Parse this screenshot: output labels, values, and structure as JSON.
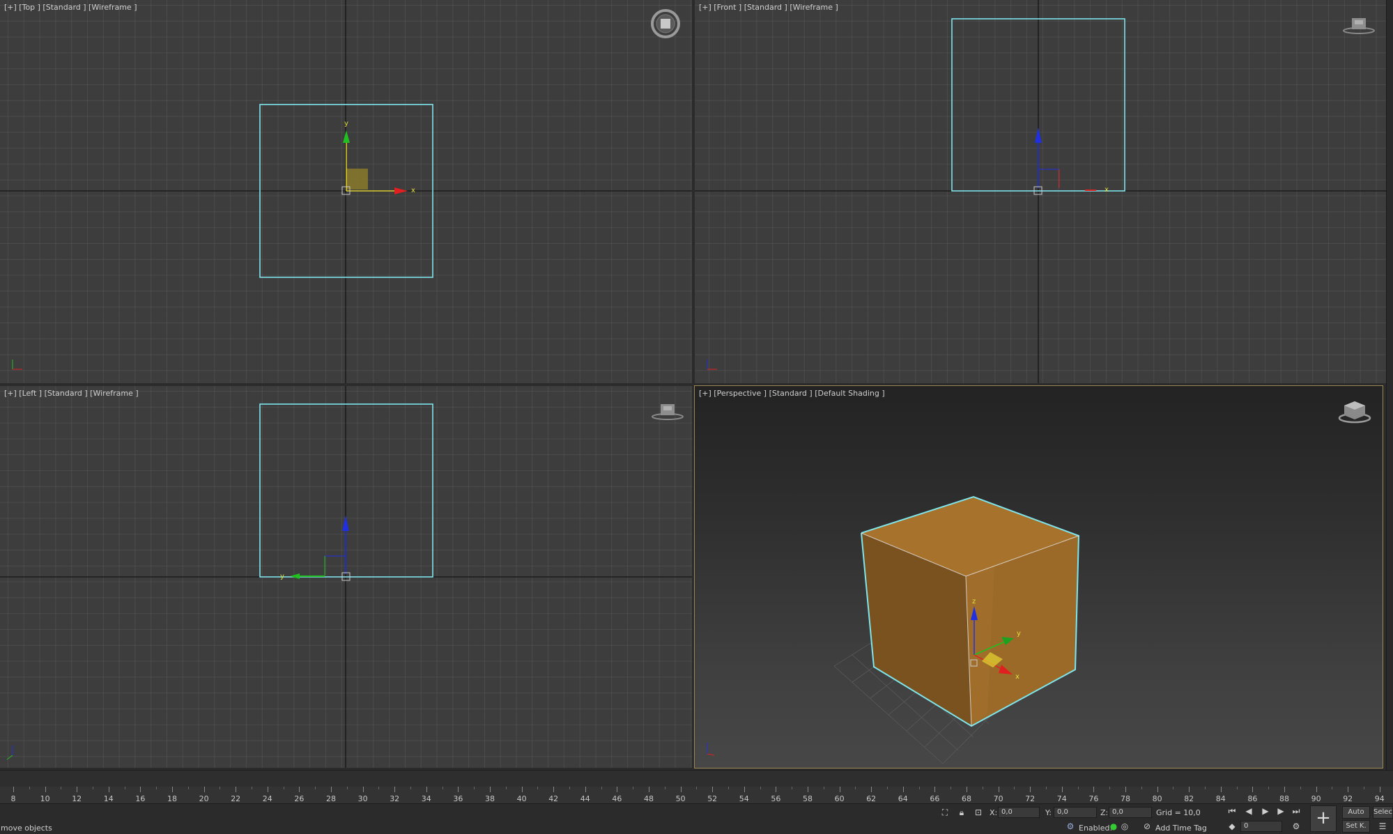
{
  "viewports": {
    "top": {
      "label": "[+] [Top ] [Standard ] [Wireframe ]"
    },
    "front": {
      "label": "[+] [Front ] [Standard ] [Wireframe ]"
    },
    "left": {
      "label": "[+] [Left ] [Standard ] [Wireframe ]"
    },
    "perspective": {
      "label": "[+] [Perspective ] [Standard ] [Default Shading ]"
    }
  },
  "axis_labels": {
    "x": "x",
    "y": "y",
    "z": "z"
  },
  "timeline": {
    "ticks": [
      "8",
      "10",
      "12",
      "14",
      "16",
      "18",
      "20",
      "22",
      "24",
      "26",
      "28",
      "30",
      "32",
      "34",
      "36",
      "38",
      "40",
      "42",
      "44",
      "46",
      "48",
      "50",
      "52",
      "54",
      "56",
      "58",
      "60",
      "62",
      "64",
      "66",
      "68",
      "70",
      "72",
      "74",
      "76",
      "78",
      "80",
      "82",
      "84",
      "86",
      "88",
      "90",
      "92",
      "94"
    ]
  },
  "statusbar": {
    "prompt": "move objects",
    "x_label": "X:",
    "x_value": "0,0",
    "y_label": "Y:",
    "y_value": "0,0",
    "z_label": "Z:",
    "z_value": "0,0",
    "grid": "Grid = 10,0",
    "enabled_label": "Enabled:",
    "time_tag": "Add Time Tag",
    "frame_value": "0",
    "auto_key": "Auto",
    "set_key": "Set K.",
    "selected": "Selec"
  },
  "colors": {
    "selection_cyan": "#7fe6ee",
    "box_orange": "#a8712c",
    "axis_x": "#e02020",
    "axis_y": "#20c020",
    "axis_z": "#2030e0"
  }
}
